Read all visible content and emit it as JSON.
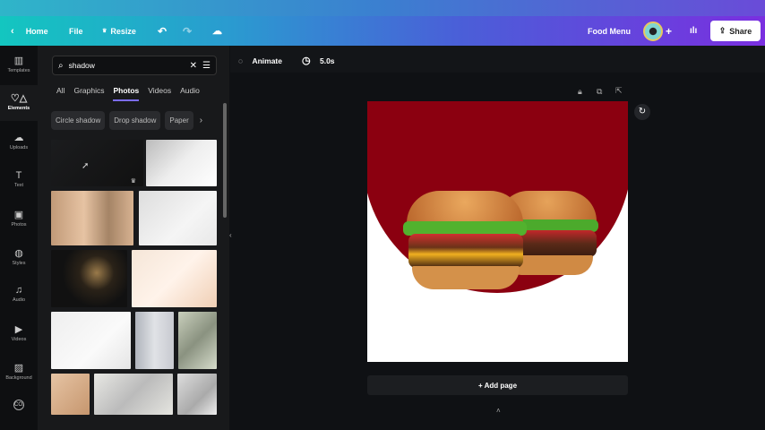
{
  "toolbar": {
    "home": "Home",
    "file": "File",
    "resize": "Resize",
    "title": "Food Menu",
    "share": "Share"
  },
  "rail": [
    {
      "label": "Templates",
      "icon": "▥"
    },
    {
      "label": "Elements",
      "icon": "♡△"
    },
    {
      "label": "Uploads",
      "icon": "☁"
    },
    {
      "label": "Text",
      "icon": "T"
    },
    {
      "label": "Photos",
      "icon": "▣"
    },
    {
      "label": "Styles",
      "icon": "◍"
    },
    {
      "label": "Audio",
      "icon": "♫"
    },
    {
      "label": "Videos",
      "icon": "▶"
    },
    {
      "label": "Background",
      "icon": "▨"
    },
    {
      "label": "",
      "icon": "CO."
    }
  ],
  "search": {
    "value": "shadow"
  },
  "tabs": [
    "All",
    "Graphics",
    "Photos",
    "Videos",
    "Audio"
  ],
  "chips": [
    "Circle shadow",
    "Drop shadow",
    "Paper"
  ],
  "canvas": {
    "animate": "Animate",
    "duration": "5.0s",
    "add_page": "+ Add page",
    "accent": "#8b0010"
  }
}
